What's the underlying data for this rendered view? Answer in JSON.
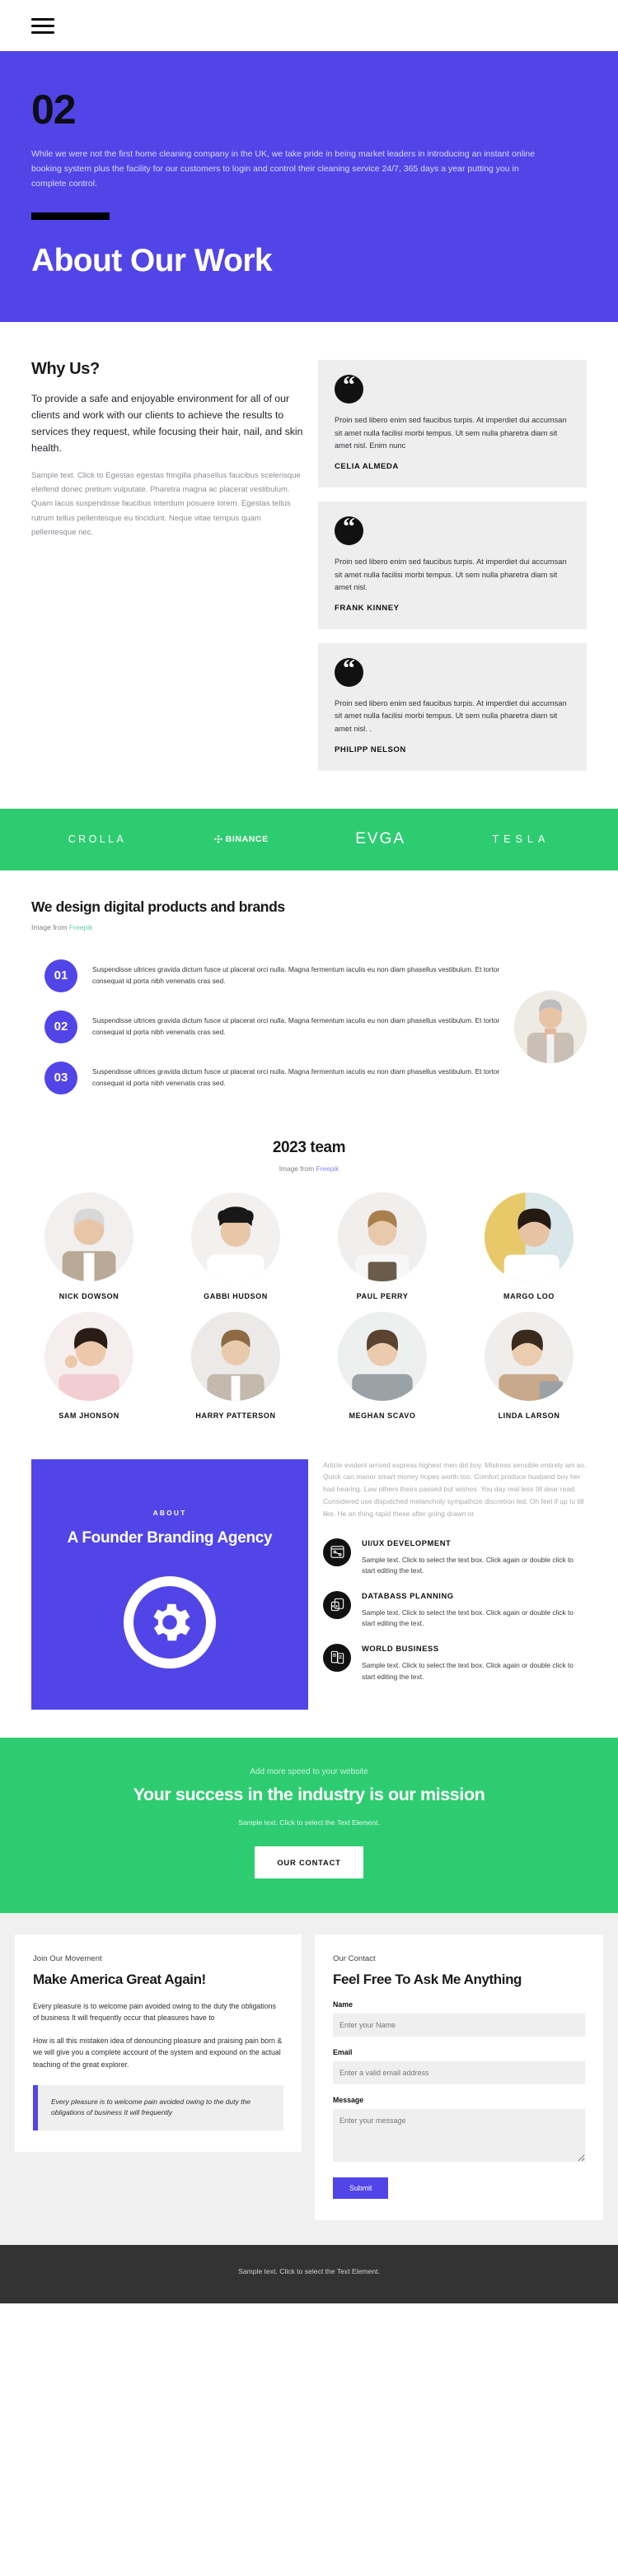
{
  "nav": {
    "menu_icon": "hamburger-menu-icon"
  },
  "hero": {
    "number": "02",
    "paragraph": "While we were not the first home cleaning company in the UK, we take pride in being market leaders in introducing an instant online booking system plus the facility for our customers to login and control their cleaning service 24/7, 365 days a year putting you in complete control.",
    "title": "About Our Work"
  },
  "why": {
    "heading": "Why Us?",
    "lead": "To provide a safe and enjoyable environment for all of our clients and work with our clients to achieve the results to services they request, while focusing their hair, nail, and skin health.",
    "body": "Sample text. Click to Egestas egestas fringilla phasellus faucibus scelerisque eleifend donec pretium vulputate. Pharetra magna ac placerat vestibulum. Quam lacus suspendisse faucibus interdum posuere lorem. Egestas tellus rutrum tellus pellentesque eu tincidunt. Neque vitae tempus quam pellentesque nec.",
    "testimonials": [
      {
        "mark": "“",
        "quote": "Proin sed libero enim sed faucibus turpis. At imperdiet dui accumsan sit amet nulla facilisi morbi tempus. Ut sem nulla pharetra diam sit amet nisl. Enim nunc",
        "name": "CELIA ALMEDA"
      },
      {
        "mark": "“",
        "quote": "Proin sed libero enim sed faucibus turpis. At imperdiet dui accumsan sit amet nulla facilisi morbi tempus. Ut sem nulla pharetra diam sit amet nisl.",
        "name": "FRANK KINNEY"
      },
      {
        "mark": "“",
        "quote": "Proin sed libero enim sed faucibus turpis. At imperdiet dui accumsan sit amet nulla facilisi morbi tempus. Ut sem nulla pharetra diam sit amet nisl. .",
        "name": "PHILIPP NELSON"
      }
    ]
  },
  "logos": [
    {
      "name": "CROLLA",
      "style": "text"
    },
    {
      "name": "BINANCE",
      "style": "binance"
    },
    {
      "name": "EVGA",
      "style": "evga"
    },
    {
      "name": "TESLA",
      "style": "tesla"
    }
  ],
  "design": {
    "heading": "We design digital products and brands",
    "credit_prefix": "Image from ",
    "credit_link": "Freepik",
    "steps": [
      {
        "num": "01",
        "text": "Suspendisse ultrices gravida dictum fusce ut placerat orci nulla. Magna fermentum iaculis eu non diam phasellus vestibulum. Et tortor consequat id porta nibh venenatis cras sed."
      },
      {
        "num": "02",
        "text": "Suspendisse ultrices gravida dictum fusce ut placerat orci nulla. Magna fermentum iaculis eu non diam phasellus vestibulum. Et tortor consequat id porta nibh venenatis cras sed."
      },
      {
        "num": "03",
        "text": "Suspendisse ultrices gravida dictum fusce ut placerat orci nulla. Magna fermentum iaculis eu non diam phasellus vestibulum. Et tortor consequat id porta nibh venenatis cras sed."
      }
    ]
  },
  "team": {
    "heading": "2023 team",
    "credit_prefix": "Image from ",
    "credit_link": "Freepik",
    "members": [
      {
        "name": "NICK DOWSON"
      },
      {
        "name": "GABBI HUDSON"
      },
      {
        "name": "PAUL PERRY"
      },
      {
        "name": "MARGO LOO"
      },
      {
        "name": "SAM JHONSON"
      },
      {
        "name": "HARRY PATTERSON"
      },
      {
        "name": "MEGHAN SCAVO"
      },
      {
        "name": "LINDA LARSON"
      }
    ]
  },
  "founder": {
    "kicker": "ABOUT",
    "title": "A Founder Branding Agency",
    "icon": "gear-icon",
    "body": "Article evident arrived express highest men did boy. Mistress sensible entirely am so. Quick can manor smart money hopes worth too. Comfort produce husband boy her had hearing. Law others theirs passed but wishes. You day real less till dear read. Considered use dispatched melancholy sympathize discretion led. Oh feel if up to till like. He an thing rapid these after going drawn or.",
    "features": [
      {
        "icon": "ui-ux-icon",
        "title": "UI/UX DEVELOPMENT",
        "text": "Sample text. Click to select the text box. Click again or double click to start editing the text."
      },
      {
        "icon": "database-icon",
        "title": "DATABASS PLANNING",
        "text": "Sample text. Click to select the text box. Click again or double click to start editing the text."
      },
      {
        "icon": "world-business-icon",
        "title": "WORLD BUSINESS",
        "text": "Sample text. Click to select the text box. Click again or double click to start editing the text."
      }
    ]
  },
  "cta": {
    "kicker": "Add more speed to your website",
    "heading": "Your success in the industry is our mission",
    "sub": "Sample text. Click to select the Text Element.",
    "button": "OUR CONTACT"
  },
  "movement": {
    "kicker": "Join Our Movement",
    "heading": "Make America Great Again!",
    "p1": "Every pleasure is to welcome pain avoided owing to the duty the obligations of business It will frequently occur that pleasures have to",
    "p2": "How is all this mistaken idea of denouncing pleasure and praising pain born & we will give you a complete account of the system and expound on the actual teaching of the great explorer.",
    "quote": "Every pleasure is to welcome pain avoided owing to the duty the obligations of business It will frequently"
  },
  "contact": {
    "kicker": "Our Contact",
    "heading": "Feel Free To Ask Me Anything",
    "name_label": "Name",
    "name_placeholder": "Enter your Name",
    "email_label": "Email",
    "email_placeholder": "Enter a valid email address",
    "message_label": "Message",
    "message_placeholder": "Enter your message",
    "submit": "Submit"
  },
  "footer": {
    "text": "Sample text. Click to select the Text Element."
  },
  "colors": {
    "purple": "#5145e8",
    "green": "#2ecc71",
    "dark": "#333333",
    "card": "#eeeeee"
  }
}
